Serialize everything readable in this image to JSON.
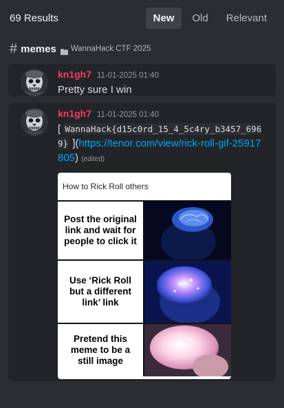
{
  "header": {
    "results_count": "69 Results",
    "tabs": [
      {
        "label": "New",
        "active": true
      },
      {
        "label": "Old",
        "active": false
      },
      {
        "label": "Relevant",
        "active": false
      }
    ]
  },
  "channel": {
    "hash": "#",
    "name": "memes",
    "category": "WannaHack CTF 2025",
    "category_icon": "folder-icon"
  },
  "results": [
    {
      "username": "kn1gh7",
      "timestamp": "11-01-2025 01:40",
      "text": "Pretty sure I win"
    },
    {
      "username": "kn1gh7",
      "timestamp": "11-01-2025 01:40",
      "bracket_open": "[ ",
      "code": "WannaHack{d15c0rd_15_4_5c4ry_b3457_6969}",
      "bracket_close": " ](",
      "link": "https://tenor.com/view/rick-roll-gif-25917805",
      "paren_close": ")",
      "edited": "(edited)",
      "meme": {
        "title": "How to Rick Roll others",
        "panels": [
          "Post the original link and wait for people to click it",
          "Use ‘Rick Roll but a different link’ link",
          "Pretend this meme to be a still image"
        ]
      }
    }
  ],
  "colors": {
    "background": "#2b2d31",
    "card": "#232428",
    "username": "#f23f61",
    "link": "#00a8fc"
  }
}
